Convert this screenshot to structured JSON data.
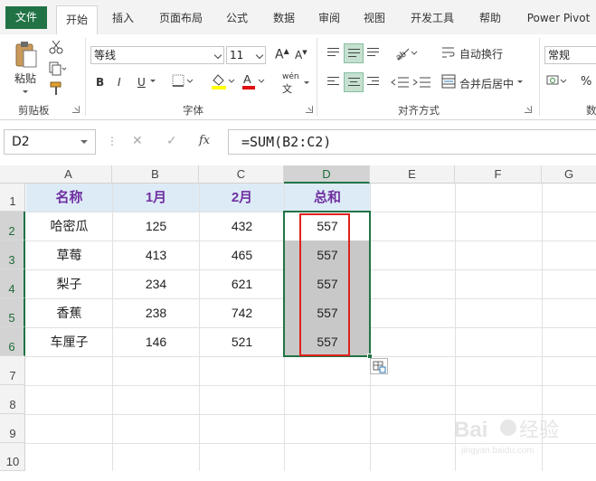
{
  "ribbon_tabs": [
    "文件",
    "开始",
    "插入",
    "页面布局",
    "公式",
    "数据",
    "审阅",
    "视图",
    "开发工具",
    "帮助",
    "Power Pivot"
  ],
  "clipboard": {
    "paste_label": "粘贴",
    "group_label": "剪贴板"
  },
  "font": {
    "name": "等线",
    "size": "11",
    "group_label": "字体",
    "bold": "B",
    "italic": "I",
    "underline": "U",
    "grow": "A",
    "shrink": "A",
    "pinyin": "wén"
  },
  "alignment": {
    "wrap_label": "自动换行",
    "merge_label": "合并后居中",
    "group_label": "对齐方式"
  },
  "number": {
    "format": "常规",
    "percent": "%",
    "group_label": "数"
  },
  "formula_bar": {
    "name_box": "D2",
    "cancel": "✕",
    "enter": "✓",
    "fx": "fx",
    "formula": "=SUM(B2:C2)"
  },
  "columns": [
    "A",
    "B",
    "C",
    "D",
    "E",
    "F",
    "G"
  ],
  "rows": [
    "1",
    "2",
    "3",
    "4",
    "5",
    "6",
    "7",
    "8",
    "9",
    "10"
  ],
  "table": {
    "headers": [
      "名称",
      "1月",
      "2月",
      "总和"
    ],
    "rows": [
      [
        "哈密瓜",
        "125",
        "432",
        "557"
      ],
      [
        "草莓",
        "413",
        "465",
        "557"
      ],
      [
        "梨子",
        "234",
        "621",
        "557"
      ],
      [
        "香蕉",
        "238",
        "742",
        "557"
      ],
      [
        "车厘子",
        "146",
        "521",
        "557"
      ]
    ]
  },
  "colors": {
    "excel_green": "#217346",
    "header_fill": "#ddebf7",
    "header_text": "#7030a0",
    "highlight_box": "#e0211c",
    "selection_fill": "#c8c8c8"
  },
  "watermark": "Baidu 经验 jingyan.baidu.com"
}
